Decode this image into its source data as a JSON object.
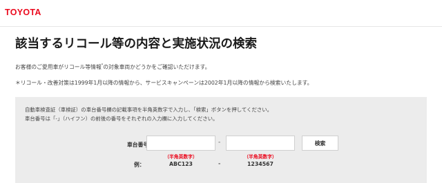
{
  "header": {
    "logo_text": "TOYOTA"
  },
  "page": {
    "title": "該当するリコール等の内容と実施状況の検索",
    "intro_text": "お客様のご愛用車がリコール等情報",
    "intro_sup": "*",
    "intro_text_after": "の対象車両かどうかをご確認いただけます。",
    "note": "＊リコール・改善対策は1999年1月以降の情報から、サービスキャンペーンは2002年1月以降の情報から検索いたします。"
  },
  "form": {
    "instruction_1": "自動車検査証（車検証）の車台番号欄の記載事項を半角英数字で入力し、「検索」ボタンを押してください。",
    "instruction_2": "車台番号は「-」（ハイフン）の前後の番号をそれぞれの入力欄に入力してください。",
    "label": "車台番号",
    "field1_value": "",
    "field1_placeholder": "",
    "separator": "-",
    "field2_value": "",
    "field2_placeholder": "",
    "search_button": "検索",
    "hint1": "（半角英数字）",
    "hint2": "（半角英数字）",
    "example_label": "例：",
    "example1": "ABC123",
    "example_separator": "-",
    "example2": "1234567"
  },
  "colors": {
    "brand": "#eb0a1e",
    "panel_bg": "#ececec",
    "hint_color": "#eb0a1e"
  }
}
